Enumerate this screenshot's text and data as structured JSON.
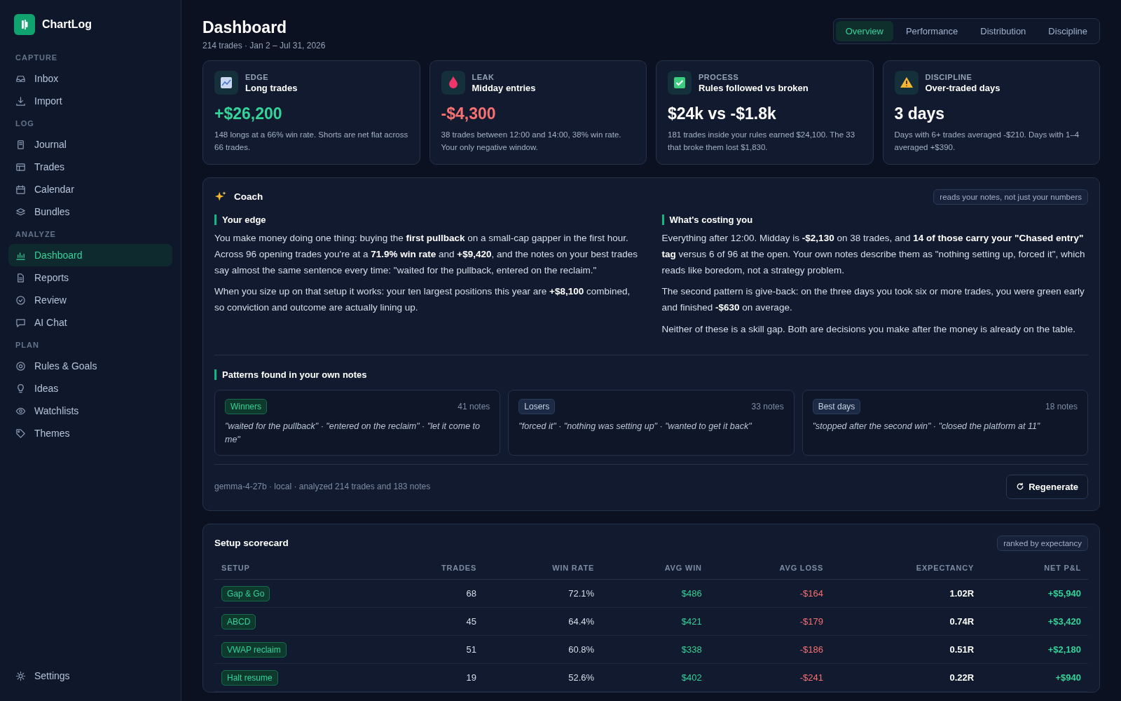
{
  "app": {
    "name": "ChartLog"
  },
  "sidebar": {
    "sections": [
      {
        "title": "CAPTURE",
        "items": [
          {
            "label": "Inbox",
            "kind": "inbox",
            "selected": false
          },
          {
            "label": "Import",
            "kind": "download",
            "selected": false
          }
        ]
      },
      {
        "title": "LOG",
        "items": [
          {
            "label": "Journal",
            "kind": "book",
            "selected": false
          },
          {
            "label": "Trades",
            "kind": "table",
            "selected": false
          },
          {
            "label": "Calendar",
            "kind": "calendar",
            "selected": false
          },
          {
            "label": "Bundles",
            "kind": "layers",
            "selected": false
          }
        ]
      },
      {
        "title": "ANALYZE",
        "items": [
          {
            "label": "Dashboard",
            "kind": "bars",
            "selected": true
          },
          {
            "label": "Reports",
            "kind": "file",
            "selected": false
          },
          {
            "label": "Review",
            "kind": "check",
            "selected": false
          },
          {
            "label": "AI Chat",
            "kind": "chat",
            "selected": false
          }
        ]
      },
      {
        "title": "PLAN",
        "items": [
          {
            "label": "Rules & Goals",
            "kind": "target",
            "selected": false
          },
          {
            "label": "Ideas",
            "kind": "bulb",
            "selected": false
          },
          {
            "label": "Watchlists",
            "kind": "eye",
            "selected": false
          },
          {
            "label": "Themes",
            "kind": "tag",
            "selected": false
          }
        ]
      }
    ],
    "footer": {
      "label": "Settings"
    }
  },
  "header": {
    "title": "Dashboard",
    "subtitle": "214 trades · Jan 2 – Jul 31, 2026"
  },
  "tabs": [
    {
      "label": "Overview",
      "selected": true
    },
    {
      "label": "Performance",
      "selected": false
    },
    {
      "label": "Distribution",
      "selected": false
    },
    {
      "label": "Discipline",
      "selected": false
    }
  ],
  "kpis": [
    {
      "category": "EDGE",
      "title": "Long trades",
      "value": "+$26,200",
      "kind": "positive",
      "note": "148 longs at a 66% win rate. Shorts are net flat across 66 trades."
    },
    {
      "category": "LEAK",
      "title": "Midday entries",
      "value": "-$4,300",
      "kind": "negative",
      "note": "38 trades between 12:00 and 14:00, 38% win rate. Your only negative window."
    },
    {
      "category": "PROCESS",
      "title": "Rules followed vs broken",
      "value": "$24k vs -$1.8k",
      "kind": "neutral",
      "note": "181 trades inside your rules earned $24,100. The 33 that broke them lost $1,830."
    },
    {
      "category": "DISCIPLINE",
      "title": "Over-traded days",
      "value": "3 days",
      "kind": "neutral",
      "note": "Days with 6+ trades averaged -$210. Days with 1–4 averaged +$390."
    }
  ],
  "coach": {
    "title": "Coach",
    "badge": "reads your notes, not just your numbers",
    "columns": [
      {
        "heading": "Your edge",
        "paragraphs": [
          "You make money doing one thing: buying the **first pullback** on a small-cap gapper in the first hour. Across 96 opening trades you're at a **71.9% win rate** and **+$9,420**, and the notes on your best trades say almost the same sentence every time: \"waited for the pullback, entered on the reclaim.\"",
          "When you size up on that setup it works: your ten largest positions this year are **+$8,100** combined, so conviction and outcome are actually lining up."
        ]
      },
      {
        "heading": "What's costing you",
        "paragraphs": [
          "Everything after 12:00. Midday is **-$2,130** on 38 trades, and **14 of those carry your \"Chased entry\" tag** versus 6 of 96 at the open. Your own notes describe them as \"nothing setting up, forced it\", which reads like boredom, not a strategy problem.",
          "The second pattern is give-back: on the three days you took six or more trades, you were green early and finished **-$630** on average.",
          "Neither of these is a skill gap. Both are decisions you make after the money is already on the table."
        ]
      }
    ],
    "patterns_heading": "Patterns found in your own notes",
    "patterns": [
      {
        "tag": "Winners",
        "kind": "positive",
        "count": "41 notes",
        "quotes": "\"waited for the pullback\" · \"entered on the reclaim\" · \"let it come to me\""
      },
      {
        "tag": "Losers",
        "kind": "neutral",
        "count": "33 notes",
        "quotes": "\"forced it\" · \"nothing was setting up\" · \"wanted to get it back\""
      },
      {
        "tag": "Best days",
        "kind": "neutral",
        "count": "18 notes",
        "quotes": "\"stopped after the second win\" · \"closed the platform at 11\""
      }
    ],
    "footer": "gemma-4-27b · local · analyzed 214 trades and 183 notes",
    "button": "Regenerate"
  },
  "scorecard": {
    "title": "Setup scorecard",
    "badge": "ranked by expectancy",
    "columns": [
      "SETUP",
      "TRADES",
      "WIN RATE",
      "AVG WIN",
      "AVG LOSS",
      "EXPECTANCY",
      "NET P&L"
    ],
    "rows": [
      [
        "Gap & Go",
        "68",
        "72.1%",
        "$486",
        "-$164",
        "1.02R",
        "+$5,940"
      ],
      [
        "ABCD",
        "45",
        "64.4%",
        "$421",
        "-$179",
        "0.74R",
        "+$3,420"
      ],
      [
        "VWAP reclaim",
        "51",
        "60.8%",
        "$338",
        "-$186",
        "0.51R",
        "+$2,180"
      ],
      [
        "Halt resume",
        "19",
        "52.6%",
        "$402",
        "-$241",
        "0.22R",
        "+$940"
      ]
    ]
  }
}
